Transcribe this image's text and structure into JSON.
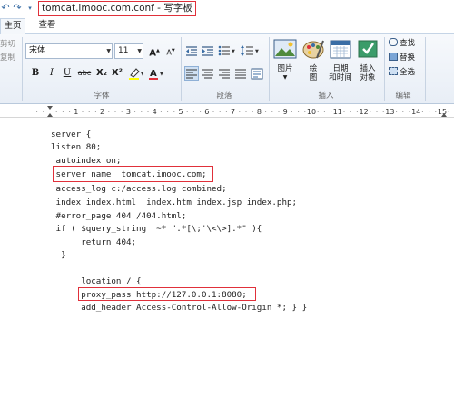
{
  "title_bar": {
    "title": "tomcat.imooc.com.conf - 写字板",
    "quick_access": [
      "undo-icon",
      "redo-icon",
      "customize-icon"
    ]
  },
  "tabs": [
    {
      "label": "主页",
      "active": true
    },
    {
      "label": "查看",
      "active": false
    }
  ],
  "ribbon": {
    "clipboard": {
      "cut": "剪切",
      "copy": "复制"
    },
    "font": {
      "group_label": "字体",
      "font_name": "宋体",
      "font_size": "11",
      "grow": "A",
      "shrink": "A",
      "bold": "B",
      "italic": "I",
      "underline": "U",
      "strike": "abc",
      "subscript": "X₂",
      "superscript": "X²"
    },
    "paragraph": {
      "group_label": "段落"
    },
    "insert": {
      "group_label": "插入",
      "picture": "图片",
      "paint": "绘\n图",
      "datetime": "日期\n和时间",
      "object": "插入\n对象"
    },
    "editing": {
      "group_label": "编辑",
      "find": "查找",
      "replace": "替换",
      "select_all": "全选"
    }
  },
  "ruler": {
    "numbers": [
      "1",
      "2",
      "3",
      "4",
      "5",
      "6",
      "7",
      "8",
      "9",
      "10",
      "11",
      "12",
      "13",
      "14",
      "15"
    ]
  },
  "document": {
    "lines": [
      "server {",
      "listen 80;",
      " autoindex on;",
      " server_name  tomcat.imooc.com;",
      " access_log c:/access.log combined;",
      " index index.html  index.htm index.jsp index.php;",
      " #error_page 404 /404.html;",
      " if ( $query_string  ~* \".*[\\;'\\<\\>].*\" ){",
      "      return 404;",
      "  }",
      "",
      "      location / {",
      "      proxy_pass http://127.0.0.1:8080;",
      "      add_header Access-Control-Allow-Origin *; } }"
    ]
  },
  "colors": {
    "highlight_border": "#e0303a",
    "ribbon_bg": "#e8eef6",
    "accent": "#3b6ea5"
  }
}
